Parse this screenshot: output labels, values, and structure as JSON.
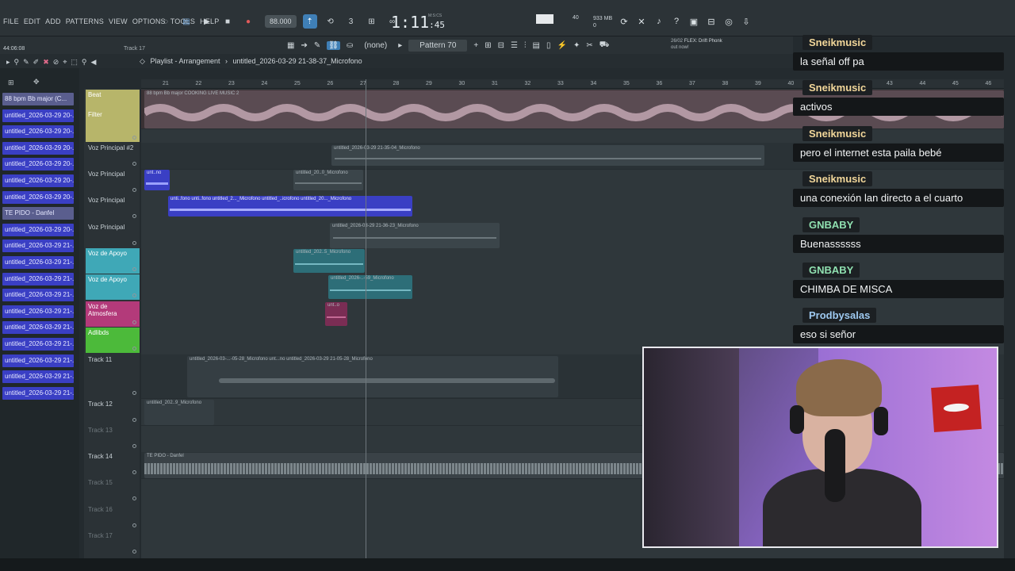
{
  "menu": [
    "FILE",
    "EDIT",
    "ADD",
    "PATTERNS",
    "VIEW",
    "OPTIONS",
    "TOOLS",
    "HELP"
  ],
  "transport": {
    "tempo": "88.000",
    "time": "1:11",
    "time_small": ":45",
    "time_label": "M:S:CS",
    "cpu": "40",
    "mem_top": "933 MB",
    "mem_bottom": "0"
  },
  "toolbar2": {
    "counter": "44:06:08",
    "track_hint": "Track 17",
    "none_label": "(none)",
    "pattern": "Pattern 70",
    "hint_date": "26/02",
    "hint_title": "FLEX: Drift Phonk",
    "hint_sub": "out now!"
  },
  "breadcrumb": {
    "section": "Playlist - Arrangement",
    "file": "untitled_2026-03-29 21-38-37_Microfono"
  },
  "left_items": [
    {
      "label": "88 bpm Bb major (C...",
      "alt": true
    },
    {
      "label": "untitled_2026-03-29 20-...",
      "alt": false
    },
    {
      "label": "untitled_2026-03-29 20-...",
      "alt": false
    },
    {
      "label": "untitled_2026-03-29 20-...",
      "alt": false
    },
    {
      "label": "untitled_2026-03-29 20-...",
      "alt": false
    },
    {
      "label": "untitled_2026-03-29 20-...",
      "alt": false
    },
    {
      "label": "untitled_2026-03-29 20-...",
      "alt": false
    },
    {
      "label": "TE PIDO - Danfel",
      "alt": true
    },
    {
      "label": "untitled_2026-03-29 20-...",
      "alt": false
    },
    {
      "label": "untitled_2026-03-29 21-...",
      "alt": false
    },
    {
      "label": "untitled_2026-03-29 21-...",
      "alt": false
    },
    {
      "label": "untitled_2026-03-29 21-...",
      "alt": false
    },
    {
      "label": "untitled_2026-03-29 21-...",
      "alt": false
    },
    {
      "label": "untitled_2026-03-29 21-...",
      "alt": false
    },
    {
      "label": "untitled_2026-03-29 21-...",
      "alt": false
    },
    {
      "label": "untitled_2026-03-29 21-...",
      "alt": false
    },
    {
      "label": "untitled_2026-03-29 21-...",
      "alt": false
    },
    {
      "label": "untitled_2026-03-29 21-...",
      "alt": false
    },
    {
      "label": "untitled_2026-03-29 21-...",
      "alt": false
    }
  ],
  "tracks": [
    {
      "name": "Beat",
      "sub": "Filter",
      "color": "#b7b56a"
    },
    {
      "name": "Voz Principal #2",
      "sub": "",
      "color": ""
    },
    {
      "name": "Voz Principal",
      "sub": "",
      "color": ""
    },
    {
      "name": "Voz Principal",
      "sub": "",
      "color": ""
    },
    {
      "name": "Voz Principal",
      "sub": "",
      "color": ""
    },
    {
      "name": "Voz de Apoyo",
      "sub": "",
      "color": "#3fa8b7"
    },
    {
      "name": "Voz de Apoyo",
      "sub": "",
      "color": "#3fa8b7"
    },
    {
      "name": "Voz de Atmosfera",
      "sub": "",
      "color": "#b33a7a"
    },
    {
      "name": "Adlibds",
      "sub": "",
      "color": "#4cba3a"
    },
    {
      "name": "Track 11",
      "sub": "",
      "color": ""
    },
    {
      "name": "Track 12",
      "sub": "",
      "color": ""
    },
    {
      "name": "Track 13",
      "sub": "",
      "color": ""
    },
    {
      "name": "Track 14",
      "sub": "",
      "color": ""
    },
    {
      "name": "Track 15",
      "sub": "",
      "color": ""
    },
    {
      "name": "Track 16",
      "sub": "",
      "color": ""
    },
    {
      "name": "Track 17",
      "sub": "",
      "color": ""
    }
  ],
  "ruler": [
    "21",
    "22",
    "23",
    "24",
    "25",
    "26",
    "27",
    "28",
    "29",
    "30",
    "31",
    "32",
    "33",
    "34",
    "35",
    "36",
    "37",
    "38",
    "39",
    "40",
    "41",
    "42",
    "43",
    "44",
    "45",
    "46"
  ],
  "clips": {
    "beat": "88 bpm Bb major COOKING LIVE MUSIC 2",
    "vp2": "untitled_2026-03-29 21-35-04_Microfono",
    "vp_a": "unt..no",
    "vp_b": "untitled_20..0_Microfono",
    "vp3": "unti..fono  unti..fono  untitled_2..._Microfono  untitled_..icrofono  untitled_20..._Microfono",
    "vp4": "untitled_2026-03-29 21-36-23_Microfono",
    "apoyo1": "untitled_202..5_Microfono",
    "apoyo2": "untitled_2026-..-59_Microfono",
    "atm": "unt..o",
    "t11": "untitled_2026-03-...-05-28_Microfono   unt...no   untitled_2026-03-29 21-05-28_Microfono",
    "t12": "untitled_202..9_Microfono",
    "t14": "TE PIDO - Danfel"
  },
  "chat": [
    {
      "user": "Sneikmusic",
      "color": "#f2d79a",
      "text": "la señal off pa"
    },
    {
      "user": "Sneikmusic",
      "color": "#f2d79a",
      "text": "activos"
    },
    {
      "user": "Sneikmusic",
      "color": "#f2d79a",
      "text": "pero el internet esta paila bebé"
    },
    {
      "user": "Sneikmusic",
      "color": "#f2d79a",
      "text": "una conexión lan directo a el cuarto"
    },
    {
      "user": "GNBABY",
      "color": "#8fe0b0",
      "text": "Buenassssss"
    },
    {
      "user": "GNBABY",
      "color": "#8fe0b0",
      "text": "CHIMBA DE MISCA"
    },
    {
      "user": "Prodbysalas",
      "color": "#9ec9f0",
      "text": "eso si señor"
    }
  ]
}
